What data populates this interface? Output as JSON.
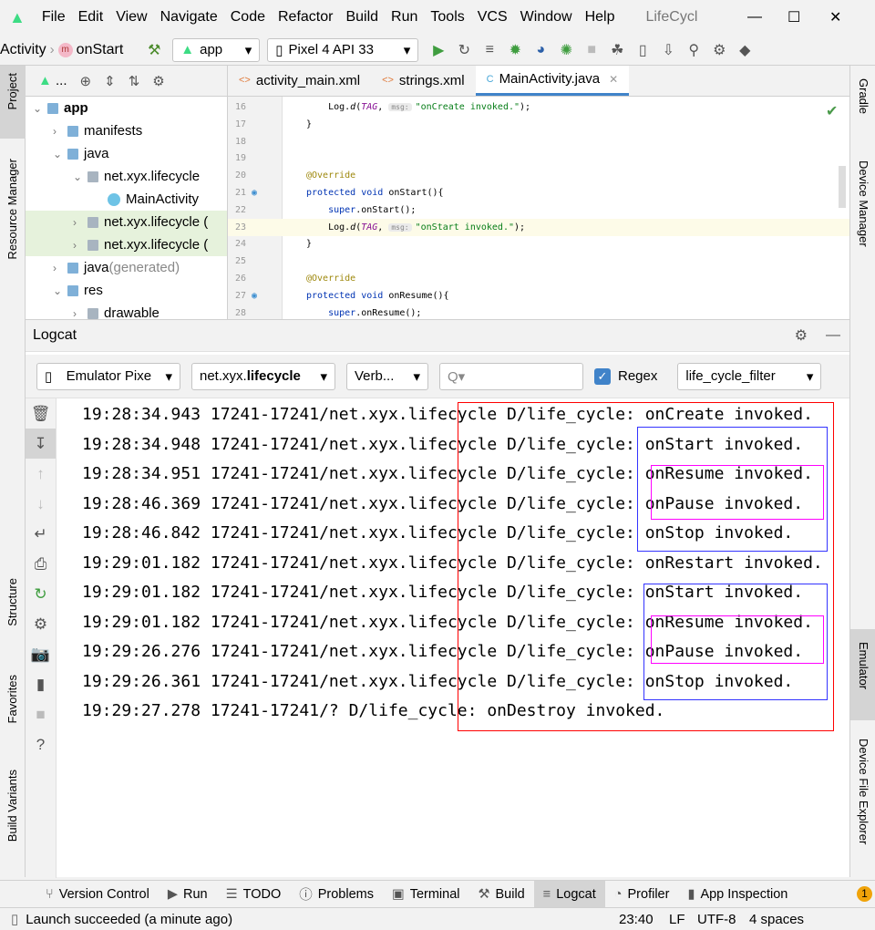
{
  "menu": {
    "items": [
      "File",
      "Edit",
      "View",
      "Navigate",
      "Code",
      "Refactor",
      "Build",
      "Run",
      "Tools",
      "VCS",
      "Window",
      "Help"
    ],
    "title": "LifeCycl"
  },
  "toolbar": {
    "breadcrumb": [
      "Activity",
      "onStart"
    ],
    "run_config": "app",
    "device": "Pixel 4 API 33"
  },
  "left_strip": {
    "project": "Project",
    "resource_manager": "Resource Manager",
    "structure": "Structure",
    "favorites": "Favorites",
    "build_variants": "Build Variants"
  },
  "right_strip": {
    "gradle": "Gradle",
    "device_manager": "Device Manager",
    "emulator": "Emulator",
    "device_file_explorer": "Device File Explorer"
  },
  "project": {
    "dropdown": "...",
    "tree": [
      {
        "label": "app",
        "indent": 0,
        "bold": true
      },
      {
        "label": "manifests",
        "indent": 1
      },
      {
        "label": "java",
        "indent": 1
      },
      {
        "label": "net.xyx.lifecycle",
        "indent": 2
      },
      {
        "label": "MainActivity",
        "indent": 3
      },
      {
        "label": "net.xyx.lifecycle (",
        "indent": 2,
        "selected": true
      },
      {
        "label": "net.xyx.lifecycle (",
        "indent": 2,
        "selected": true
      },
      {
        "label": "java",
        "suffix": " (generated)",
        "indent": 1
      },
      {
        "label": "res",
        "indent": 1
      },
      {
        "label": "drawable",
        "indent": 2
      }
    ]
  },
  "editor": {
    "tabs": [
      {
        "label": "activity_main.xml"
      },
      {
        "label": "strings.xml"
      },
      {
        "label": "MainActivity.java",
        "active": true
      }
    ],
    "lines": [
      {
        "n": "16",
        "html": "    Log.<i>d</i>(<span class='it'>TAG</span>, <span class='hint'>msg:</span><span class='st'>\"onCreate invoked.\"</span>);"
      },
      {
        "n": "17",
        "html": "}"
      },
      {
        "n": "18",
        "html": ""
      },
      {
        "n": "19",
        "html": ""
      },
      {
        "n": "20",
        "html": "<span class='an'>@Override</span>"
      },
      {
        "n": "21",
        "html": "<span class='kw'>protected void</span> onStart(){"
      },
      {
        "n": "22",
        "html": "    <span class='kw'>super</span>.onStart();"
      },
      {
        "n": "23",
        "html": "    Log.<i>d</i>(<span class='it'>TAG</span>, <span class='hint'>msg:</span><span class='st'>\"onStart invoked.\"</span>);"
      },
      {
        "n": "24",
        "html": "}"
      },
      {
        "n": "25",
        "html": ""
      },
      {
        "n": "26",
        "html": "<span class='an'>@Override</span>"
      },
      {
        "n": "27",
        "html": "<span class='kw'>protected void</span> onResume(){"
      },
      {
        "n": "28",
        "html": "    <span class='kw'>super</span>.onResume();"
      }
    ]
  },
  "logcat": {
    "title": "Logcat",
    "device": "Emulator Pixe",
    "package_prefix": "net.xyx.",
    "package_bold": "lifecycle",
    "level": "Verb...",
    "search_placeholder": "Q▾",
    "regex_label": "Regex",
    "regex_checked": true,
    "filter": "life_cycle_filter",
    "lines": [
      "19:28:34.943 17241-17241/net.xyx.lifecycle D/life_cycle: onCreate invoked.",
      "19:28:34.948 17241-17241/net.xyx.lifecycle D/life_cycle: onStart invoked.",
      "19:28:34.951 17241-17241/net.xyx.lifecycle D/life_cycle: onResume invoked.",
      "19:28:46.369 17241-17241/net.xyx.lifecycle D/life_cycle: onPause invoked.",
      "19:28:46.842 17241-17241/net.xyx.lifecycle D/life_cycle: onStop invoked.",
      "19:29:01.182 17241-17241/net.xyx.lifecycle D/life_cycle: onRestart invoked.",
      "19:29:01.182 17241-17241/net.xyx.lifecycle D/life_cycle: onStart invoked.",
      "19:29:01.182 17241-17241/net.xyx.lifecycle D/life_cycle: onResume invoked.",
      "19:29:26.276 17241-17241/net.xyx.lifecycle D/life_cycle: onPause invoked.",
      "19:29:26.361 17241-17241/net.xyx.lifecycle D/life_cycle: onStop invoked.",
      "19:29:27.278 17241-17241/? D/life_cycle: onDestroy invoked."
    ],
    "annotation_colors": {
      "outer": "#ff0000",
      "start_stop": "#3333ff",
      "resume_pause": "#ff00ff"
    }
  },
  "bottom_tabs": [
    {
      "label": "Version Control",
      "icon": "branch-icon"
    },
    {
      "label": "Run",
      "icon": "play-icon"
    },
    {
      "label": "TODO",
      "icon": "list-icon"
    },
    {
      "label": "Problems",
      "icon": "alert-icon"
    },
    {
      "label": "Terminal",
      "icon": "terminal-icon"
    },
    {
      "label": "Build",
      "icon": "hammer-icon"
    },
    {
      "label": "Logcat",
      "icon": "logcat-icon",
      "active": true
    },
    {
      "label": "Profiler",
      "icon": "gauge-icon"
    },
    {
      "label": "App Inspection",
      "icon": "inspection-icon"
    }
  ],
  "notification_count": "1",
  "status": {
    "message": "Launch succeeded (a minute ago)",
    "position": "23:40",
    "line_sep": "LF",
    "encoding": "UTF-8",
    "indent": "4 spaces"
  }
}
